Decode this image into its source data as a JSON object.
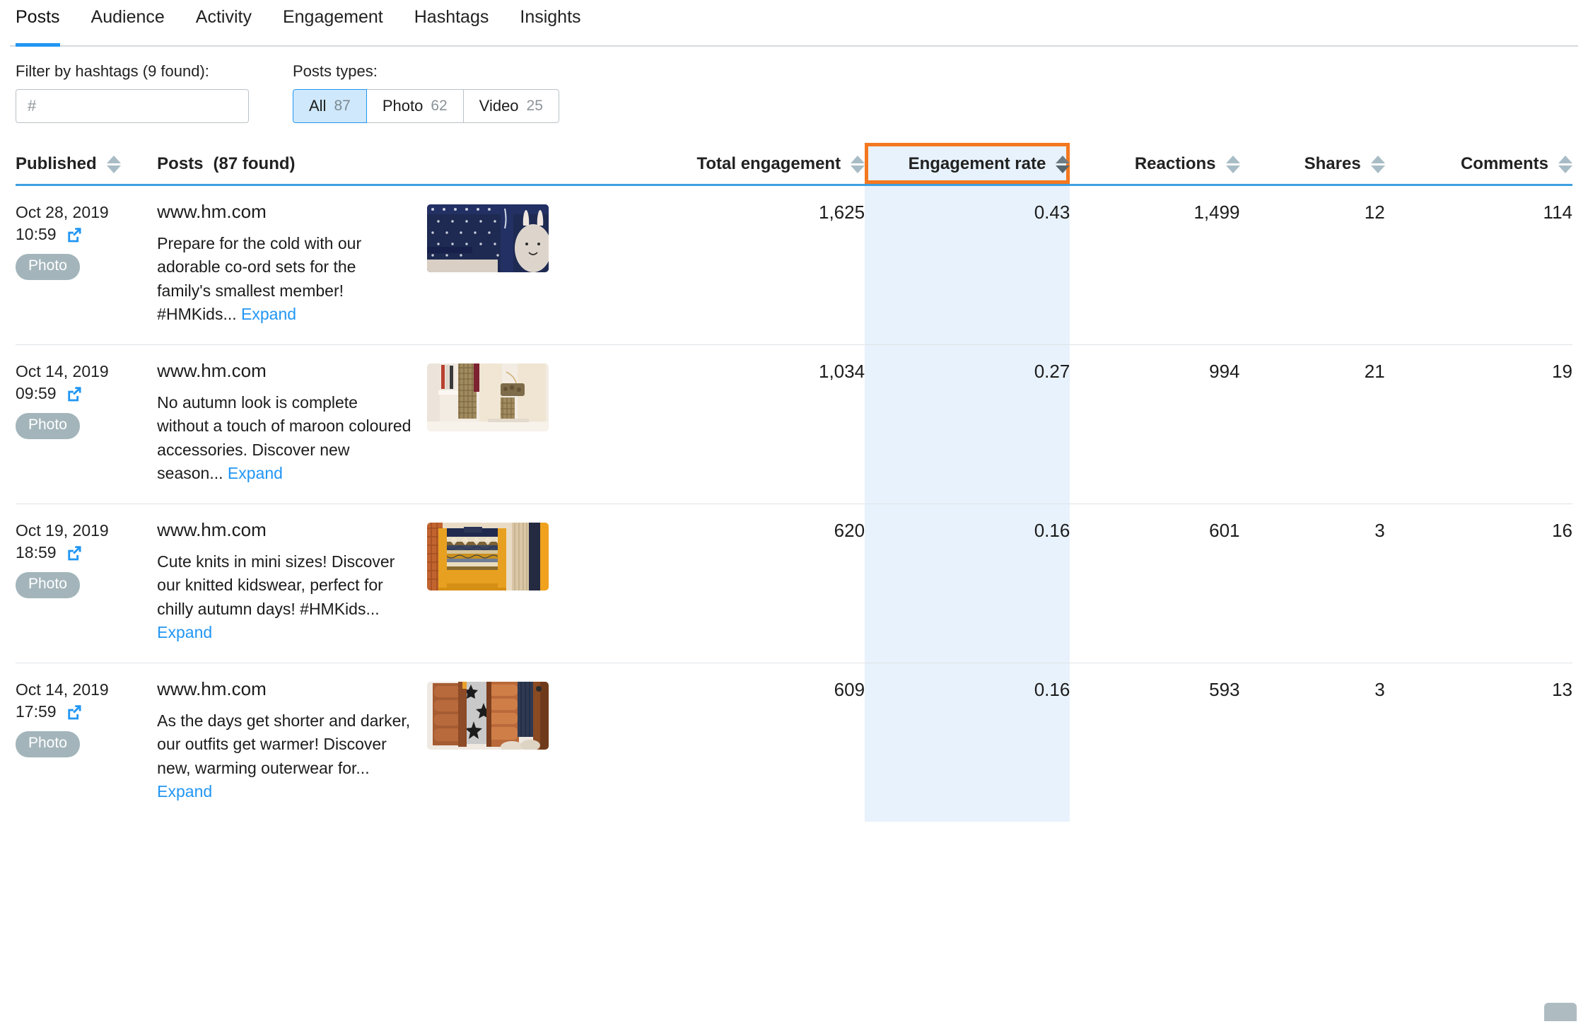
{
  "tabs": [
    {
      "label": "Posts",
      "active": true
    },
    {
      "label": "Audience",
      "active": false
    },
    {
      "label": "Activity",
      "active": false
    },
    {
      "label": "Engagement",
      "active": false
    },
    {
      "label": "Hashtags",
      "active": false
    },
    {
      "label": "Insights",
      "active": false
    }
  ],
  "filters": {
    "hashtags_label": "Filter by hashtags (9 found):",
    "hashtags_placeholder": "#",
    "hashtags_value": "",
    "posts_types_label": "Posts types:",
    "types": [
      {
        "label": "All",
        "count": "87",
        "active": true
      },
      {
        "label": "Photo",
        "count": "62",
        "active": false
      },
      {
        "label": "Video",
        "count": "25",
        "active": false
      }
    ]
  },
  "table": {
    "columns": [
      {
        "label": "Published",
        "align": "left",
        "sortable": true,
        "active": false
      },
      {
        "label": "Posts",
        "suffix": "(87 found)",
        "align": "left",
        "sortable": false,
        "active": false
      },
      {
        "label": "Total engagement",
        "align": "right",
        "sortable": true,
        "active": false
      },
      {
        "label": "Engagement rate",
        "align": "right",
        "sortable": true,
        "active": true,
        "highlighted": true
      },
      {
        "label": "Reactions",
        "align": "right",
        "sortable": true,
        "active": false
      },
      {
        "label": "Shares",
        "align": "right",
        "sortable": true,
        "active": false
      },
      {
        "label": "Comments",
        "align": "right",
        "sortable": true,
        "active": false
      }
    ],
    "rows": [
      {
        "date": "Oct 28, 2019",
        "time": "10:59",
        "type_badge": "Photo",
        "domain": "www.hm.com",
        "text": "Prepare for the cold with our adorable co-ord sets for the family's smallest member! #HMKids...",
        "expand_label": "Expand",
        "thumbnail": "navy-dotted-knit-with-bunny-plush",
        "total_engagement": "1,625",
        "engagement_rate": "0.43",
        "reactions": "1,499",
        "shares": "12",
        "comments": "114"
      },
      {
        "date": "Oct 14, 2019",
        "time": "09:59",
        "type_badge": "Photo",
        "domain": "www.hm.com",
        "text": "No autumn look is complete without a touch of maroon coloured accessories. Discover new season...",
        "expand_label": "Expand",
        "thumbnail": "cream-knitwear-and-checked-skirt-on-rail",
        "total_engagement": "1,034",
        "engagement_rate": "0.27",
        "reactions": "994",
        "shares": "21",
        "comments": "19"
      },
      {
        "date": "Oct 19, 2019",
        "time": "18:59",
        "type_badge": "Photo",
        "domain": "www.hm.com",
        "text": "Cute knits in mini sizes! Discover our knitted kidswear, perfect for chilly autumn days! #HMKids...",
        "expand_label": "Expand",
        "thumbnail": "yellow-fair-isle-kids-sweater",
        "total_engagement": "620",
        "engagement_rate": "0.16",
        "reactions": "601",
        "shares": "3",
        "comments": "16"
      },
      {
        "date": "Oct 14, 2019",
        "time": "17:59",
        "type_badge": "Photo",
        "domain": "www.hm.com",
        "text": "As the days get shorter and darker, our outfits get warmer! Discover new, warming outerwear for...",
        "expand_label": "Expand",
        "thumbnail": "copper-puffer-jacket-over-star-print-top",
        "total_engagement": "609",
        "engagement_rate": "0.16",
        "reactions": "593",
        "shares": "3",
        "comments": "13"
      }
    ]
  },
  "colors": {
    "accent_blue": "#2196f3",
    "highlight_orange": "#f4781f",
    "highlight_column_bg": "#e8f2fc",
    "badge_gray": "#a3b5bb",
    "header_rule_blue": "#3e9fe0"
  }
}
